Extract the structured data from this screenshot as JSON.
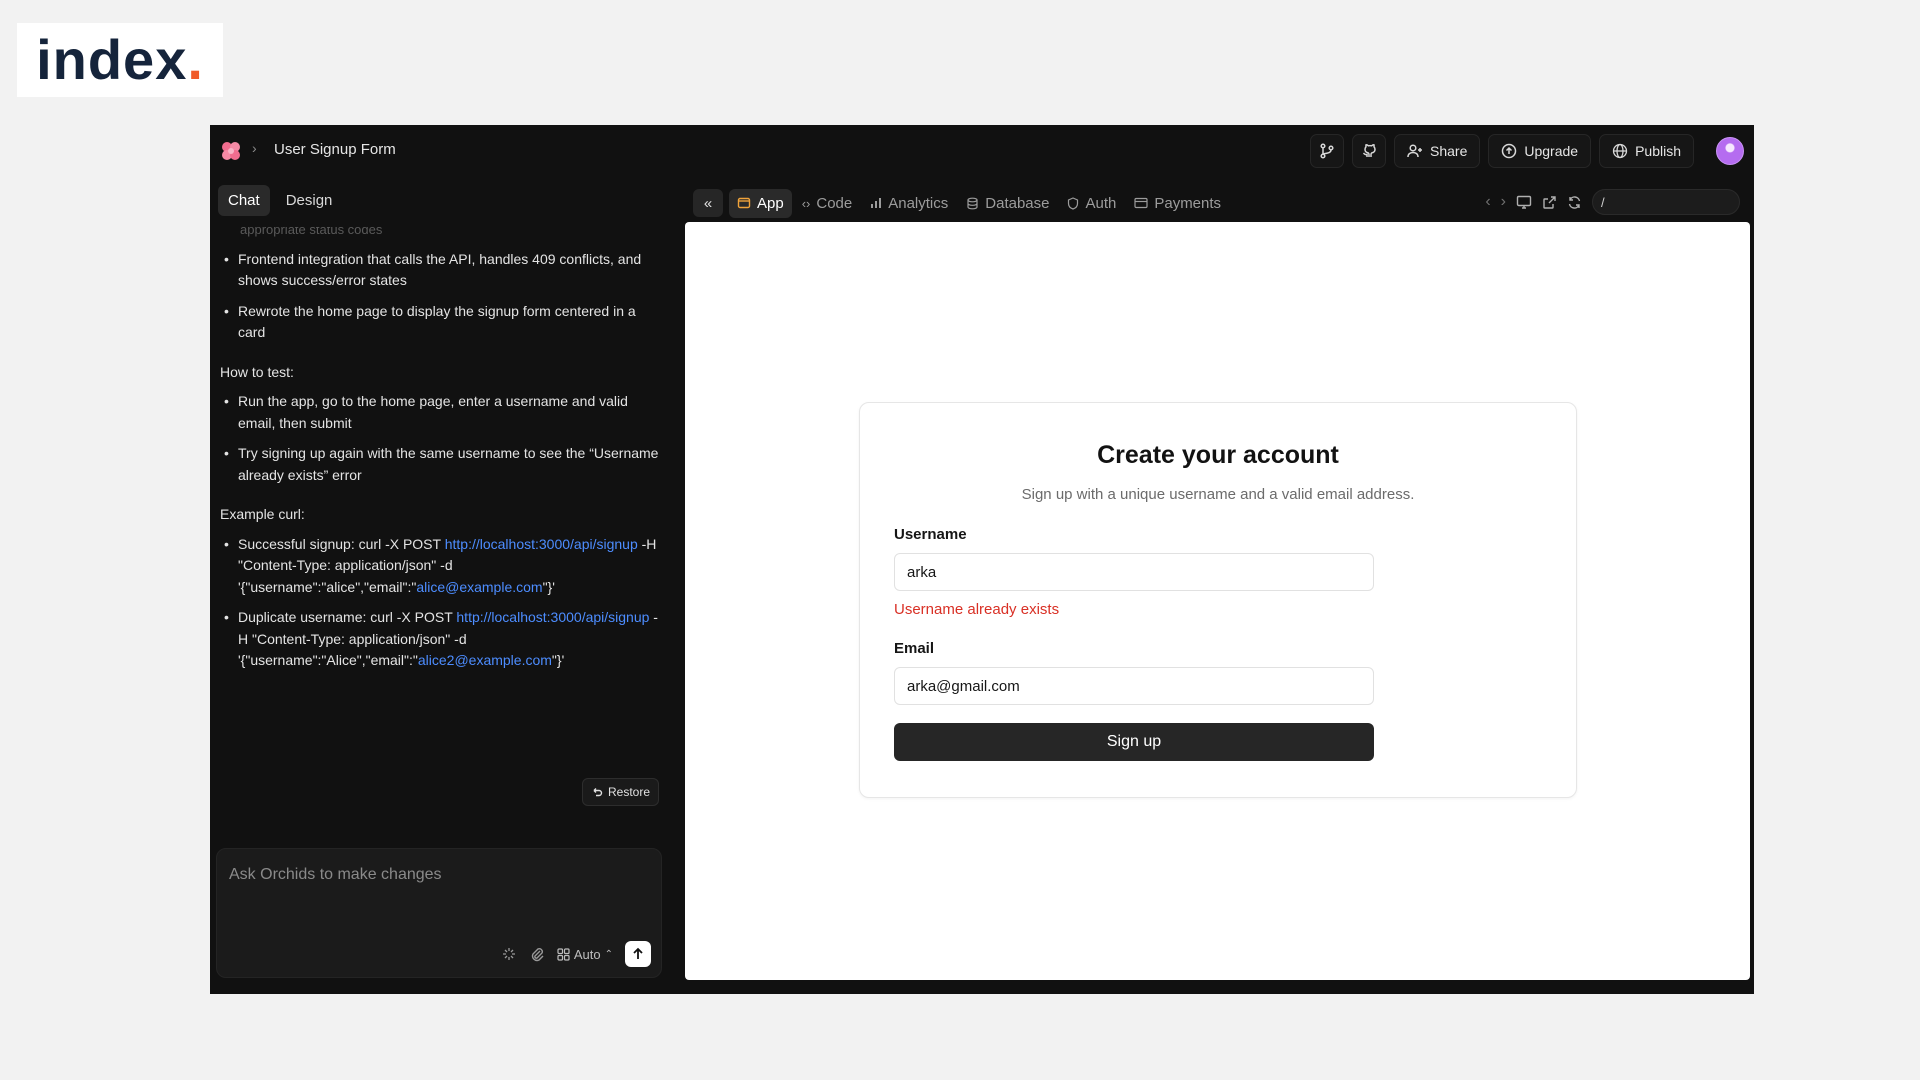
{
  "logo": {
    "text": "index",
    "dot": "."
  },
  "header": {
    "project_title": "User Signup Form",
    "share_label": "Share",
    "upgrade_label": "Upgrade",
    "publish_label": "Publish"
  },
  "left_panel": {
    "tabs": [
      {
        "label": "Chat",
        "active": true
      },
      {
        "label": "Design",
        "active": false
      }
    ],
    "faded_line": "appropriate status codes",
    "summary_items": [
      "Frontend integration that calls the API, handles 409 conflicts, and shows success/error states",
      "Rewrote the home page to display the signup form centered in a card"
    ],
    "how_to_test_label": "How to test:",
    "test_items": [
      "Run the app, go to the home page, enter a username and valid email, then submit",
      "Try signing up again with the same username to see the “Username already exists” error"
    ],
    "example_label": "Example curl:",
    "examples": [
      {
        "prefix": "Successful signup: curl -X POST ",
        "url": "http://localhost:3000/api/signup",
        "middle": " -H \"Content-Type: application/json\" -d '{\"username\":\"alice\",\"email\":\"",
        "email": "alice@example.com",
        "suffix": "\"}'"
      },
      {
        "prefix": "Duplicate username: curl -X POST ",
        "url": "http://localhost:3000/api/signup",
        "middle": " -H \"Content-Type: application/json\" -d '{\"username\":\"Alice\",\"email\":\"",
        "email": "alice2@example.com",
        "suffix": "\"}'"
      }
    ],
    "restore_label": "Restore",
    "composer": {
      "placeholder": "Ask Orchids to make changes",
      "mode_label": "Auto"
    }
  },
  "right_panel": {
    "tabs": [
      {
        "label": "App",
        "active": true
      },
      {
        "label": "Code",
        "active": false
      },
      {
        "label": "Analytics",
        "active": false
      },
      {
        "label": "Database",
        "active": false
      },
      {
        "label": "Auth",
        "active": false
      },
      {
        "label": "Payments",
        "active": false
      }
    ],
    "path_value": "/"
  },
  "signup_form": {
    "title": "Create your account",
    "subtitle": "Sign up with a unique username and a valid email address.",
    "username_label": "Username",
    "username_value": "arka",
    "error_text": "Username already exists",
    "email_label": "Email",
    "email_value": "arka@gmail.com",
    "submit_label": "Sign up"
  },
  "colors": {
    "app_bg": "#111111",
    "link": "#4d8dff",
    "error": "#d93025",
    "primary_button": "#262626",
    "logo_accent": "#f05a28"
  }
}
